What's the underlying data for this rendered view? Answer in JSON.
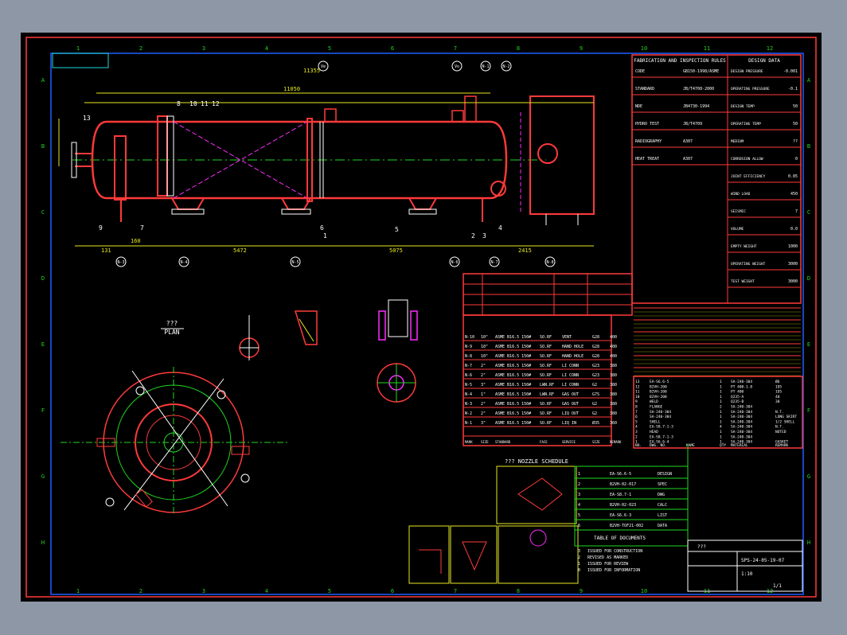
{
  "drawing": {
    "grid_cols": [
      "1",
      "2",
      "3",
      "4",
      "5",
      "6",
      "7",
      "8",
      "9",
      "10",
      "11",
      "12"
    ],
    "grid_rows": [
      "A",
      "B",
      "C",
      "D",
      "E",
      "F",
      "G",
      "H"
    ],
    "plan_title": "???",
    "plan_subtitle": "PLAN",
    "nozzle_schedule_title": "??? NOZZLE SCHEDULE",
    "table_of_documents": "TABLE OF DOCUMENTS",
    "fabrication_title": "FABRICATION AND INSPECTION RULES",
    "design_data_title": "DESIGN DATA",
    "dim_total": "11050",
    "dim_center": "5472",
    "dim_center2": "5075",
    "dim_right": "2415",
    "dim_left": "131",
    "dim_gap": "160",
    "top_length": "11355",
    "parts_callouts": [
      "13",
      "8",
      "10",
      "11",
      "12",
      "1",
      "2",
      "3",
      "4",
      "5",
      "6",
      "7",
      "9"
    ],
    "top_notes": [
      "Ve",
      "Vo",
      "N-1",
      "N-2",
      "N-3",
      "N-4",
      "N-5",
      "N-6",
      "N-7",
      "N-8"
    ],
    "detail_titles": [
      "SKIRT & HEAD WELDING DETAIL",
      "WELD",
      "G6",
      "G2",
      "G1",
      "G3"
    ]
  },
  "nozzles": [
    {
      "mark": "N-1",
      "size": "3\"",
      "standard": "ASME B16.5 150#",
      "face": "SO.RF",
      "service": "LIQ IN",
      "size2": "Ø35",
      "remark": "360"
    },
    {
      "mark": "N-2",
      "size": "2\"",
      "standard": "ASME B16.5 150#",
      "face": "SO.RF",
      "service": "LIQ OUT",
      "size2": "G2",
      "remark": "380"
    },
    {
      "mark": "N-3",
      "size": "2\"",
      "standard": "ASME B16.5 150#",
      "face": "SO.RF",
      "service": "GAS OUT",
      "size2": "G2",
      "remark": "380"
    },
    {
      "mark": "N-4",
      "size": "1\"",
      "standard": "ASME B16.5 150#",
      "face": "LWN.RF",
      "service": "GAS OUT",
      "size2": "G7S",
      "remark": "380"
    },
    {
      "mark": "N-5",
      "size": "3\"",
      "standard": "ASME B16.5 150#",
      "face": "LWN.RF",
      "service": "LI CONN",
      "size2": "G2",
      "remark": "380"
    },
    {
      "mark": "N-6",
      "size": "2\"",
      "standard": "ASME B16.5 150#",
      "face": "SO.RF",
      "service": "LI CONN",
      "size2": "G23",
      "remark": "380"
    },
    {
      "mark": "N-7",
      "size": "2\"",
      "standard": "ASME B16.5 150#",
      "face": "SO.RF",
      "service": "LI CONN",
      "size2": "G23",
      "remark": "380"
    },
    {
      "mark": "N-8",
      "size": "10\"",
      "standard": "ASME B16.5 150#",
      "face": "SO.RF",
      "service": "HAND HOLE",
      "size2": "G28",
      "remark": "400"
    },
    {
      "mark": "N-9",
      "size": "10\"",
      "standard": "ASME B16.5 150#",
      "face": "SO.RF",
      "service": "HAND HOLE",
      "size2": "G28",
      "remark": "400"
    },
    {
      "mark": "N-10",
      "size": "10\"",
      "standard": "ASME B16.5 150#",
      "face": "SO.RF",
      "service": "VENT",
      "size2": "G28",
      "remark": "400"
    }
  ],
  "nozzle_headers": [
    "MARK",
    "SIZE",
    "STANDARD",
    "FACE",
    "SERVICE",
    "SIZE",
    "REMARK"
  ],
  "revisions": [
    {
      "rev": "3",
      "desc": "ISSUED FOR CONSTRUCTION"
    },
    {
      "rev": "2",
      "desc": "REVISED AS MARKED"
    },
    {
      "rev": "1",
      "desc": "ISSUED FOR REVIEW"
    },
    {
      "rev": "0",
      "desc": "ISSUED FOR INFORMATION"
    }
  ],
  "bom": [
    {
      "no": "13",
      "name": "EA-S6.6-5",
      "qty": "1",
      "material": "SA-240-304",
      "remark": "Ø6"
    },
    {
      "no": "12",
      "name": "B2VH-200",
      "qty": "1",
      "material": "PT 400-1.0",
      "remark": "1D5"
    },
    {
      "no": "11",
      "name": "B2VH-200",
      "qty": "1",
      "material": "PT 400",
      "remark": "1D5"
    },
    {
      "no": "10",
      "name": "B2VH-200",
      "qty": "1",
      "material": "Q235-A",
      "remark": "40"
    },
    {
      "no": "9",
      "name": "WELD",
      "qty": "1",
      "material": "Q235-B",
      "remark": "30"
    },
    {
      "no": "8",
      "name": "FLANGE",
      "qty": "2",
      "material": "SA-240-304",
      "remark": ""
    },
    {
      "no": "7",
      "name": "SA-240-304",
      "qty": "1",
      "material": "SA-240-304",
      "remark": "N.T."
    },
    {
      "no": "6",
      "name": "SA-240-304",
      "qty": "1",
      "material": "SA-240-304",
      "remark": "LONG SKIRT"
    },
    {
      "no": "5",
      "name": "SHELL",
      "qty": "1",
      "material": "SA-240-304",
      "remark": "1/2 SHELL"
    },
    {
      "no": "4",
      "name": "EA-S8.7-1-3",
      "qty": "4",
      "material": "SA-240-304",
      "remark": "N.T."
    },
    {
      "no": "3",
      "name": "HEAD",
      "qty": "1",
      "material": "SA-240-304",
      "remark": "NOTED"
    },
    {
      "no": "2",
      "name": "EA-S8.7-1-3",
      "qty": "1",
      "material": "SA-240-304",
      "remark": ""
    },
    {
      "no": "1",
      "name": "EA-S6.6-4",
      "qty": "1",
      "material": "SA-240-304",
      "remark": "GASKET"
    }
  ],
  "bom_headers": [
    "NO.",
    "DWG. NO.",
    "NAME",
    "QTY",
    "MATERIAL",
    "REMARK"
  ],
  "design_rows": [
    {
      "label": "DESIGN PRESSURE",
      "value": "-0.001"
    },
    {
      "label": "OPERATING PRESSURE",
      "value": "-0.1"
    },
    {
      "label": "DESIGN TEMP",
      "value": "50"
    },
    {
      "label": "OPERATING TEMP",
      "value": "50"
    },
    {
      "label": "MEDIUM",
      "value": "??"
    },
    {
      "label": "CORROSION ALLOW",
      "value": "0"
    },
    {
      "label": "JOINT EFFICIENCY",
      "value": "0.85"
    },
    {
      "label": "WIND LOAD",
      "value": "450"
    },
    {
      "label": "SEISMIC",
      "value": "7"
    },
    {
      "label": "VOLUME",
      "value": "0.0"
    },
    {
      "label": "EMPTY WEIGHT",
      "value": "1000"
    },
    {
      "label": "OPERATING WEIGHT",
      "value": "3000"
    },
    {
      "label": "TEST WEIGHT",
      "value": "3000"
    }
  ],
  "fab_rows": [
    {
      "label": "CODE",
      "value": "GB150-1998/ASME"
    },
    {
      "label": "STANDARD",
      "value": "JB/T4708-2000"
    },
    {
      "label": "NDE",
      "value": "JB4730-1994"
    },
    {
      "label": "HYDRO TEST",
      "value": "JB/T4709"
    },
    {
      "label": "RADIOGRAPHY",
      "value": "A307"
    },
    {
      "label": "HEAT TREAT",
      "value": "A307"
    }
  ],
  "docs": [
    {
      "no": "EA-S6.6-5",
      "title": "DESIGN"
    },
    {
      "no": "B2VH-02-017",
      "title": "SPEC"
    },
    {
      "no": "EA-S8.7-1",
      "title": "DWG"
    },
    {
      "no": "B2VH-02-023",
      "title": "CALC"
    },
    {
      "no": "EA-S6.6-3",
      "title": "LIST"
    },
    {
      "no": "B2VH-TOF21-002",
      "title": "DATA"
    }
  ],
  "title_block": {
    "company": "???",
    "dwg_no": "SPS-24-05-19-07",
    "scale": "1:10",
    "sheet": "1/1"
  },
  "colors": {
    "bg": "#000000",
    "frame": "#ff3a3a",
    "line": "#ffffff",
    "accent": "#1fd81f",
    "yellow": "#e8e81f",
    "magenta": "#ff2cff",
    "cyan": "#1fd8d8"
  }
}
